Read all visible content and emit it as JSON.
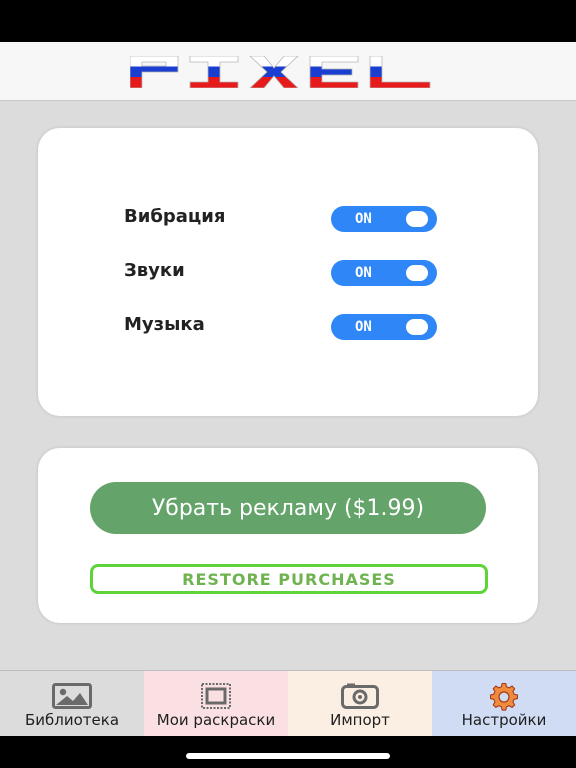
{
  "header": {
    "logo_text": "PIXEL",
    "logo_colors": [
      "#ffffff",
      "#1a3fd0",
      "#e61a1a"
    ]
  },
  "settings": [
    {
      "label": "Вибрация",
      "state": "ON"
    },
    {
      "label": "Звуки",
      "state": "ON"
    },
    {
      "label": "Музыка",
      "state": "ON"
    }
  ],
  "purchases": {
    "remove_ads_label": "Убрать рекламу ($1.99)",
    "restore_label": "RESTORE PURCHASES"
  },
  "tabs": [
    {
      "label": "Библиотека",
      "icon": "image-icon",
      "bg": "#dcdcdc"
    },
    {
      "label": "Мои раскраски",
      "icon": "frame-icon",
      "bg": "#fbe0e3"
    },
    {
      "label": "Импорт",
      "icon": "camera-icon",
      "bg": "#fbeee2"
    },
    {
      "label": "Настройки",
      "icon": "gear-icon",
      "bg": "#d0dcf3",
      "active": true
    }
  ],
  "colors": {
    "toggle_on": "#2f86f6",
    "remove_ads_bg": "#64a36a",
    "restore_border": "#5fd33a",
    "active_tab_bg": "#d0dcf3"
  }
}
